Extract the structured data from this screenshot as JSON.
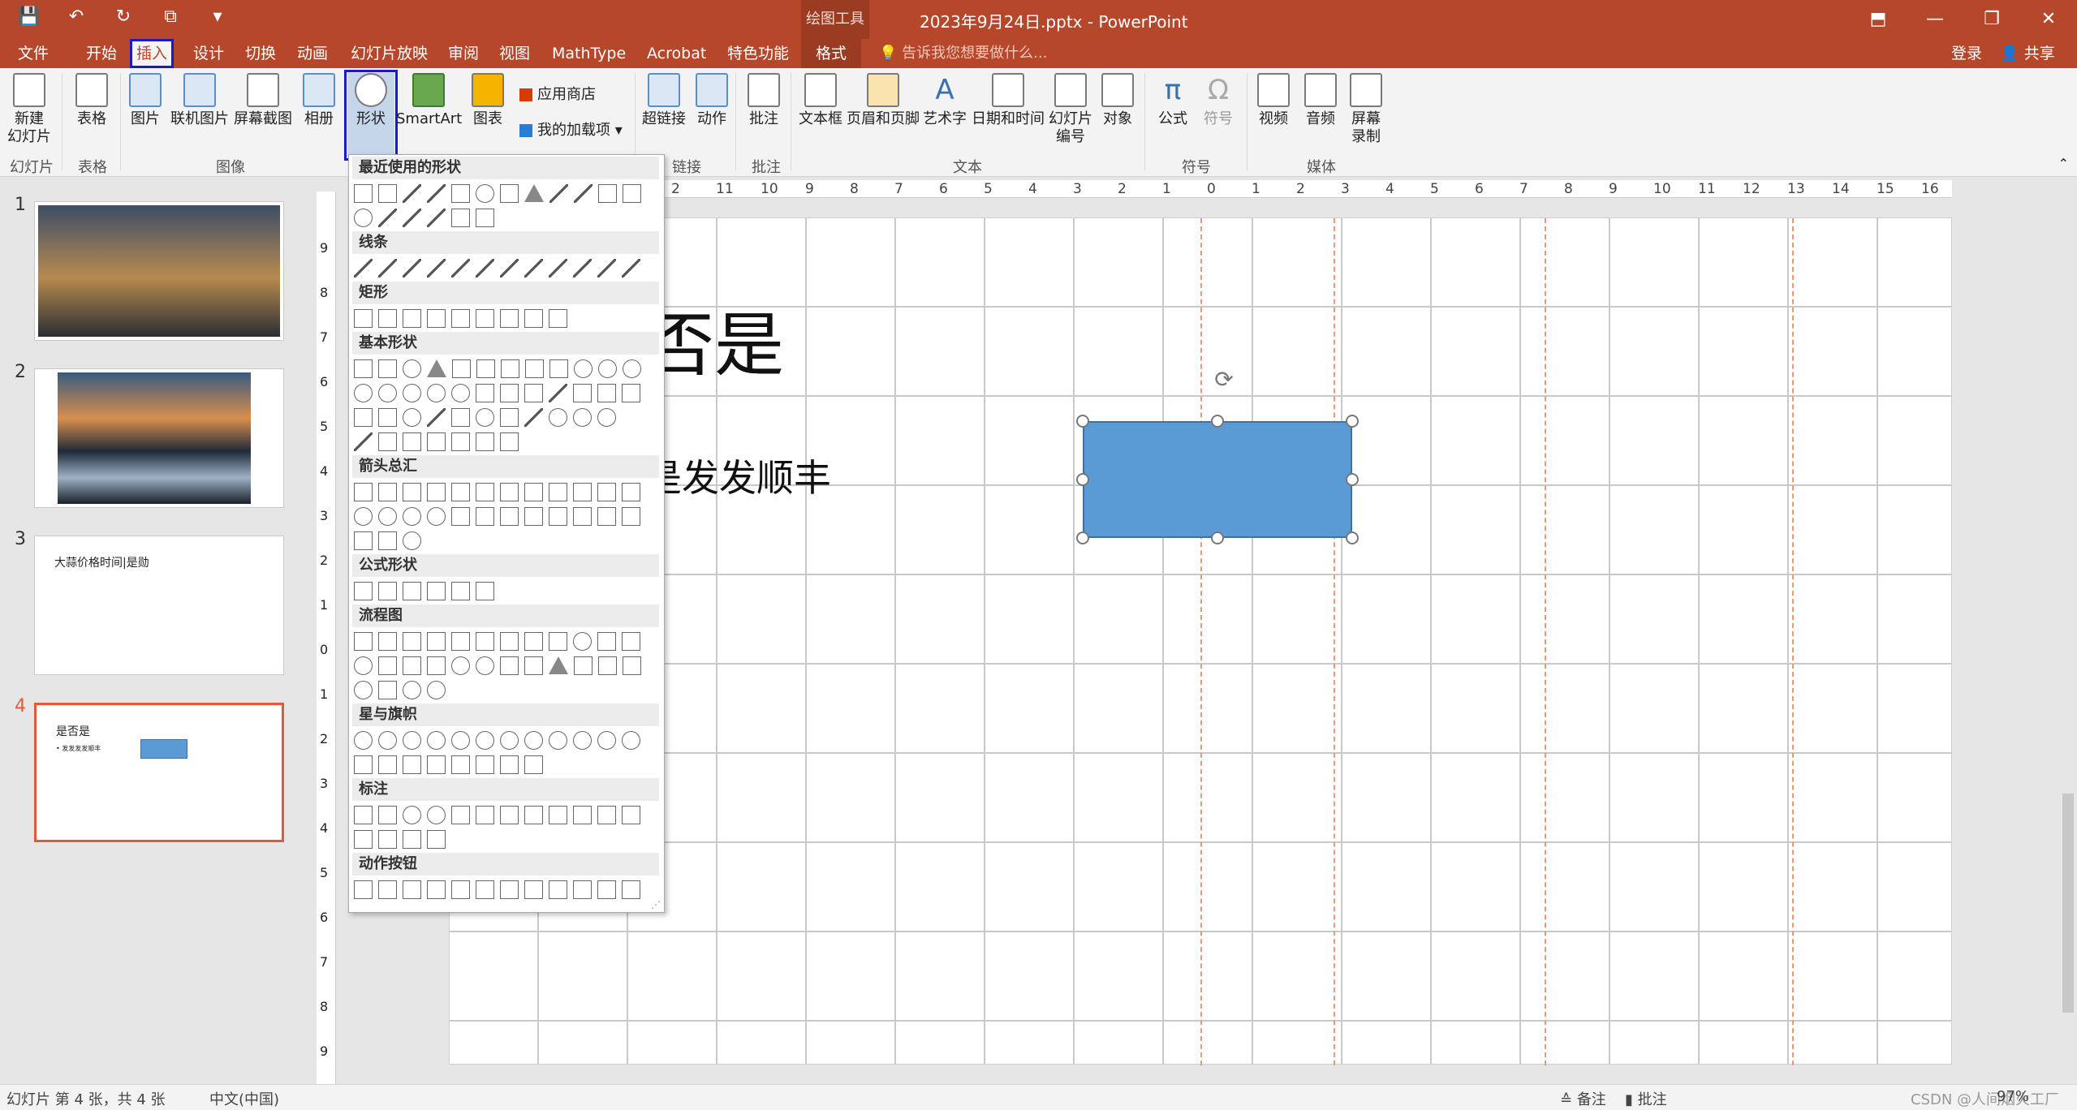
{
  "app": {
    "title": "2023年9月24日.pptx - PowerPoint",
    "context_tools": "绘图工具"
  },
  "qat": [
    "save",
    "undo",
    "undo-dropdown",
    "redo",
    "present",
    "customize"
  ],
  "tabs": {
    "file": "文件",
    "home": "开始",
    "insert": "插入",
    "design": "设计",
    "transitions": "切换",
    "animations": "动画",
    "slideshow": "幻灯片放映",
    "review": "审阅",
    "view": "视图",
    "mathtype": "MathType",
    "acrobat": "Acrobat",
    "special": "特色功能",
    "format": "格式"
  },
  "tellme": "告诉我您想要做什么...",
  "signin": "登录",
  "share": "共享",
  "ribbon": {
    "new_slide": "新建\n幻灯片",
    "table": "表格",
    "picture": "图片",
    "online_pic": "联机图片",
    "screenshot": "屏幕截图",
    "album": "相册",
    "shapes": "形状",
    "smartart": "SmartArt",
    "chart": "图表",
    "appstore": "应用商店",
    "addins": "我的加载项",
    "hyperlink": "超链接",
    "action": "动作",
    "comment": "批注",
    "textbox": "文本框",
    "header": "页眉和页脚",
    "wordart": "艺术字",
    "datetime": "日期和时间",
    "slidenum": "幻灯片\n编号",
    "object": "对象",
    "equation": "公式",
    "symbol": "符号",
    "video": "视频",
    "audio": "音频",
    "screenrec": "屏幕\n录制",
    "groups": {
      "slides": "幻灯片",
      "tables": "表格",
      "images": "图像",
      "links": "链接",
      "comments": "批注",
      "text": "文本",
      "symbols": "符号",
      "media": "媒体"
    }
  },
  "ruler": [
    "2",
    "11",
    "10",
    "9",
    "8",
    "7",
    "6",
    "5",
    "4",
    "3",
    "2",
    "1",
    "0",
    "1",
    "2",
    "3",
    "4",
    "5",
    "6",
    "7",
    "8",
    "9",
    "10",
    "11",
    "12",
    "13",
    "14",
    "15",
    "16"
  ],
  "vruler": [
    "9",
    "8",
    "7",
    "6",
    "5",
    "4",
    "3",
    "2",
    "1",
    "0",
    "1",
    "2",
    "3",
    "4",
    "5",
    "6",
    "7",
    "8",
    "9"
  ],
  "thumbs": {
    "n1": "1",
    "n2": "2",
    "n3": "3",
    "n4": "4",
    "t3_text": "大蒜价格时间|是勋",
    "t4_title": "是否是",
    "t4_bullet": "• 发发发发顺丰"
  },
  "slide": {
    "title": "否是",
    "body": "是发发顺丰"
  },
  "shape_panel": {
    "recent": "最近使用的形状",
    "lines": "线条",
    "rect": "矩形",
    "basic": "基本形状",
    "arrows": "箭头总汇",
    "equation": "公式形状",
    "flowchart": "流程图",
    "stars": "星与旗帜",
    "callouts": "标注",
    "action": "动作按钮"
  },
  "status": {
    "slide": "幻灯片 第 4 张，共 4 张",
    "lang": "中文(中国)",
    "notes": "备注",
    "comments": "批注",
    "zoom": "97%",
    "watermark": "CSDN @人间烟火工厂"
  },
  "colors": {
    "brand": "#b7472a",
    "shape_fill": "#5b9bd5",
    "selected_border": "#e05b3a"
  }
}
